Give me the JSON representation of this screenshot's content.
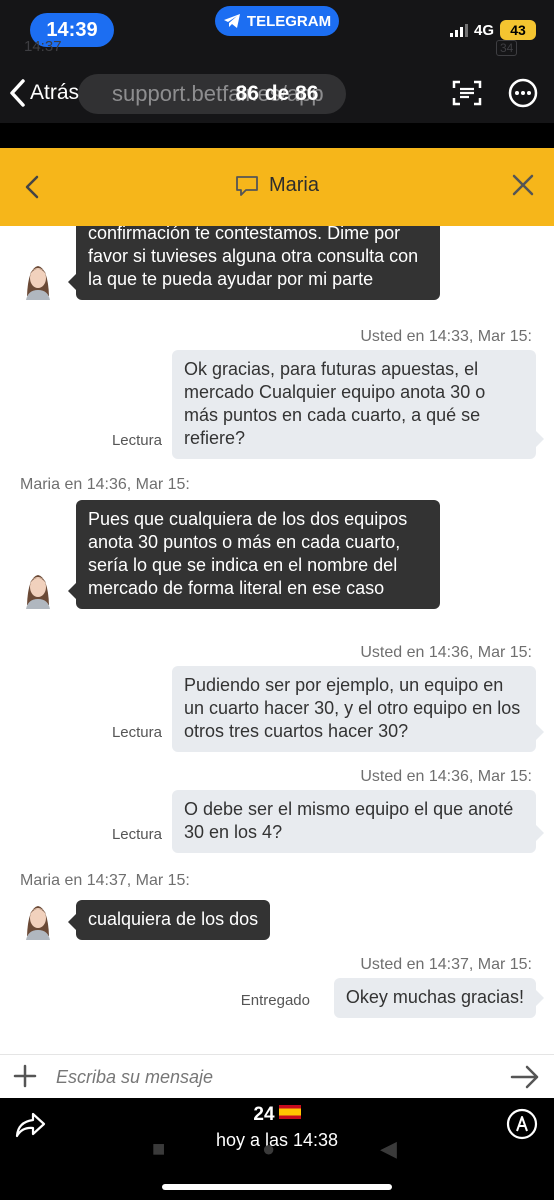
{
  "status_bar": {
    "time": "14:39",
    "underlay_time": "14:37",
    "notification_app": "TELEGRAM",
    "network": "4G",
    "battery": "43",
    "underlay_battery": "34"
  },
  "viewer_nav": {
    "back_label": "Atrás",
    "counter": "86 de 86",
    "underlay_url": "support.betfair.es/app"
  },
  "chat_header": {
    "agent_name": "Maria"
  },
  "messages": {
    "m1": {
      "text": "confirmación te contestamos. Dime por favor si tuvieses alguna otra consulta con la que te pueda ayudar por mi parte"
    },
    "m2": {
      "meta": "Usted en 14:33, Mar 15:",
      "text": "Ok gracias, para futuras apuestas, el mercado Cualquier equipo anota 30 o más puntos en cada cuarto, a qué se refiere?",
      "receipt": "Lectura"
    },
    "m3": {
      "meta": "Maria en 14:36, Mar 15:",
      "text": "Pues que cualquiera de los dos equipos anota 30 puntos o más en cada cuarto, sería lo que se indica en el nombre del mercado de forma literal en ese caso"
    },
    "m4": {
      "meta": "Usted en 14:36, Mar 15:",
      "text": "Pudiendo ser por ejemplo, un equipo en un cuarto hacer 30, y el otro equipo en los otros tres cuartos hacer 30?",
      "receipt": "Lectura"
    },
    "m5": {
      "meta": "Usted en 14:36, Mar 15:",
      "text": "O debe ser el mismo equipo el que anoté 30 en los 4?",
      "receipt": "Lectura"
    },
    "m6": {
      "meta": "Maria en 14:37, Mar 15:",
      "text": "cualquiera de los dos"
    },
    "m7": {
      "meta": "Usted en 14:37, Mar 15:",
      "text": "Okey muchas gracias!",
      "receipt": "Entregado"
    }
  },
  "composer": {
    "placeholder": "Escriba su mensaje"
  },
  "viewer_footer": {
    "count": "24",
    "date": "hoy a las 14:38"
  },
  "colors": {
    "header_yellow": "#f6b61a",
    "agent_bubble": "#333333",
    "user_bubble": "#e8ebef",
    "pill_blue": "#1c6ef2"
  }
}
